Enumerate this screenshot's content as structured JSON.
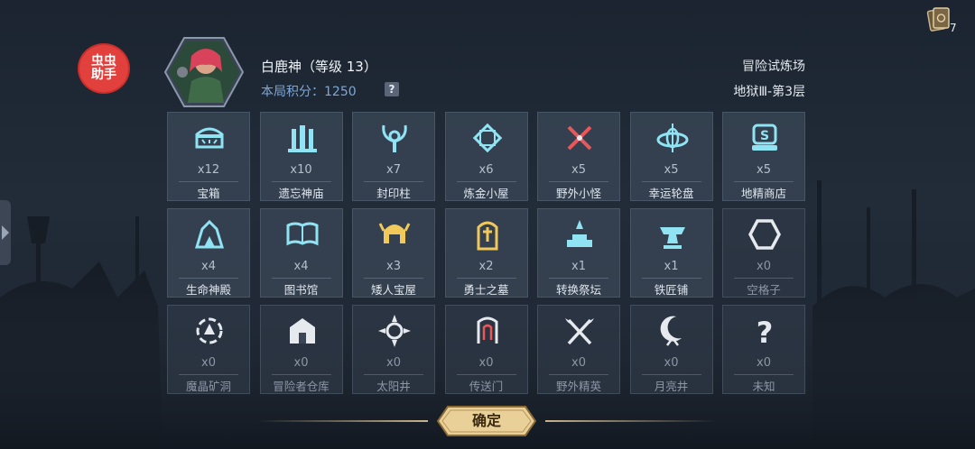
{
  "helper": {
    "label": "虫虫\n助手"
  },
  "cards": {
    "count": "7"
  },
  "hero": {
    "name": "白鹿神（等级 13）",
    "score": "本局积分：1250",
    "help": "?"
  },
  "mode": {
    "name": "冒险试炼场",
    "floor": "地狱Ⅲ-第3层"
  },
  "tiles": [
    {
      "count": "x12",
      "label": "宝箱",
      "icon": "treasure-chest-icon"
    },
    {
      "count": "x10",
      "label": "遗忘神庙",
      "icon": "temple-icon"
    },
    {
      "count": "x7",
      "label": "封印柱",
      "icon": "seal-pillar-icon"
    },
    {
      "count": "x6",
      "label": "炼金小屋",
      "icon": "alchemy-icon"
    },
    {
      "count": "x5",
      "label": "野外小怪",
      "icon": "crossed-swords-icon"
    },
    {
      "count": "x5",
      "label": "幸运轮盘",
      "icon": "wheel-icon"
    },
    {
      "count": "x5",
      "label": "地精商店",
      "icon": "shop-icon"
    },
    {
      "count": "x4",
      "label": "生命神殿",
      "icon": "life-shrine-icon"
    },
    {
      "count": "x4",
      "label": "图书馆",
      "icon": "library-icon"
    },
    {
      "count": "x3",
      "label": "矮人宝屋",
      "icon": "dwarf-helmet-icon"
    },
    {
      "count": "x2",
      "label": "勇士之墓",
      "icon": "tomb-icon"
    },
    {
      "count": "x1",
      "label": "转换祭坛",
      "icon": "altar-icon"
    },
    {
      "count": "x1",
      "label": "铁匠铺",
      "icon": "anvil-icon"
    },
    {
      "count": "x0",
      "label": "空格子",
      "icon": "empty-hexagon-icon"
    },
    {
      "count": "x0",
      "label": "魔晶矿洞",
      "icon": "crystal-mine-icon"
    },
    {
      "count": "x0",
      "label": "冒险者仓库",
      "icon": "warehouse-icon"
    },
    {
      "count": "x0",
      "label": "太阳井",
      "icon": "sun-icon"
    },
    {
      "count": "x0",
      "label": "传送门",
      "icon": "portal-icon"
    },
    {
      "count": "x0",
      "label": "野外精英",
      "icon": "crossed-axes-icon"
    },
    {
      "count": "x0",
      "label": "月亮井",
      "icon": "moon-icon"
    },
    {
      "count": "x0",
      "label": "未知",
      "icon": "question-icon"
    }
  ],
  "confirm": {
    "label": "确定"
  }
}
